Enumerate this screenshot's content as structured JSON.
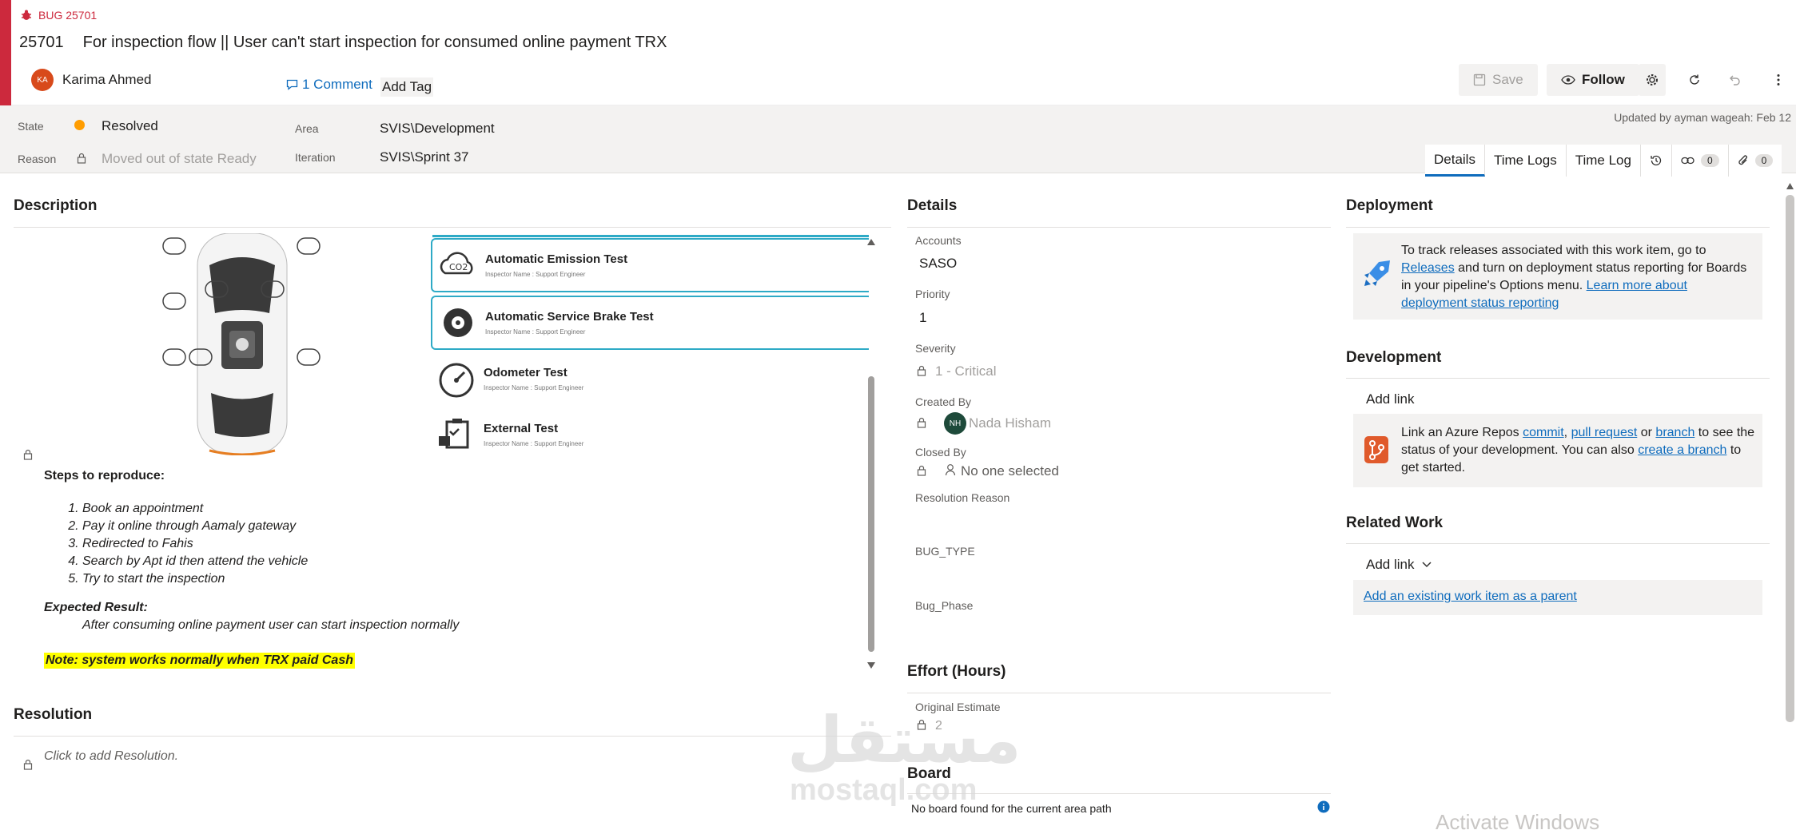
{
  "header": {
    "type_label": "BUG 25701",
    "id": "25701",
    "title": "For inspection flow || User can't start inspection for consumed online payment TRX",
    "author_initials": "KA",
    "author_name": "Karima Ahmed",
    "comment_label": "1 Comment",
    "add_tag_label": "Add Tag",
    "save_label": "Save",
    "follow_label": "Follow"
  },
  "fields": {
    "state_label": "State",
    "state_value": "Resolved",
    "reason_label": "Reason",
    "reason_value": "Moved out of state Ready",
    "area_label": "Area",
    "area_value": "SVIS\\Development",
    "iteration_label": "Iteration",
    "iteration_value": "SVIS\\Sprint 37",
    "updated_text": "Updated by ayman wageah: Feb 12"
  },
  "tabs": [
    {
      "label": "Details"
    },
    {
      "label": "Time Logs"
    },
    {
      "label": "Time Log"
    },
    {
      "label": "0"
    },
    {
      "label": "0"
    }
  ],
  "description": {
    "heading": "Description",
    "inspections": [
      {
        "title": "Automatic Emission Test",
        "sub": "Inspector Name : Support Engineer"
      },
      {
        "title": "Automatic Service Brake Test",
        "sub": "Inspector Name : Support Engineer"
      },
      {
        "title": "Odometer Test",
        "sub": "Inspector Name : Support Engineer"
      },
      {
        "title": "External Test",
        "sub": "Inspector Name : Support Engineer"
      }
    ],
    "steps_heading": "Steps to reproduce:",
    "steps": [
      "Book an appointment",
      "Pay it online through Aamaly gateway",
      "Redirected to Fahis",
      "Search by Apt id then attend the vehicle",
      "Try to start the inspection"
    ],
    "expected_heading": "Expected Result:",
    "expected_text": "After consuming online payment user can start inspection normally",
    "note": "Note: system works normally when TRX paid Cash"
  },
  "resolution": {
    "heading": "Resolution",
    "placeholder": "Click to add Resolution."
  },
  "details": {
    "heading": "Details",
    "accounts_label": "Accounts",
    "accounts_value": "SASO",
    "priority_label": "Priority",
    "priority_value": "1",
    "severity_label": "Severity",
    "severity_value": "1 - Critical",
    "created_by_label": "Created By",
    "created_by_initials": "NH",
    "created_by_value": "Nada Hisham",
    "closed_by_label": "Closed By",
    "closed_by_value": "No one selected",
    "resolution_reason_label": "Resolution Reason",
    "bug_type_label": "BUG_TYPE",
    "bug_phase_label": "Bug_Phase"
  },
  "effort": {
    "heading": "Effort (Hours)",
    "original_estimate_label": "Original Estimate",
    "original_estimate_value": "2"
  },
  "board": {
    "heading": "Board",
    "message": "No board found for the current area path"
  },
  "deployment": {
    "heading": "Deployment",
    "text1": "To track releases associated with this work item, go to",
    "releases_link": "Releases",
    "text2": "and turn on deployment status reporting for Boards in your pipeline's Options menu.",
    "learn_link": "Learn more about deployment status reporting"
  },
  "development": {
    "heading": "Development",
    "add_link": "Add link",
    "text1": "Link an Azure Repos",
    "commit_link": "commit",
    "pull_request_link": "pull request",
    "or": "or",
    "branch_link": "branch",
    "text2": "to see the status of your development. You can also",
    "create_branch_link": "create a branch",
    "text3": "to get started."
  },
  "related_work": {
    "heading": "Related Work",
    "add_link": "Add link",
    "add_existing": "Add an existing work item as a parent"
  },
  "watermark": {
    "arabic": "مستقل",
    "latin": "mostaql.com",
    "activate": "Activate Windows"
  },
  "colors": {
    "bug_red": "#cc293d",
    "state_resolved": "#ff9d00",
    "link_blue": "#0f6cbd",
    "highlight": "#ffff00"
  }
}
